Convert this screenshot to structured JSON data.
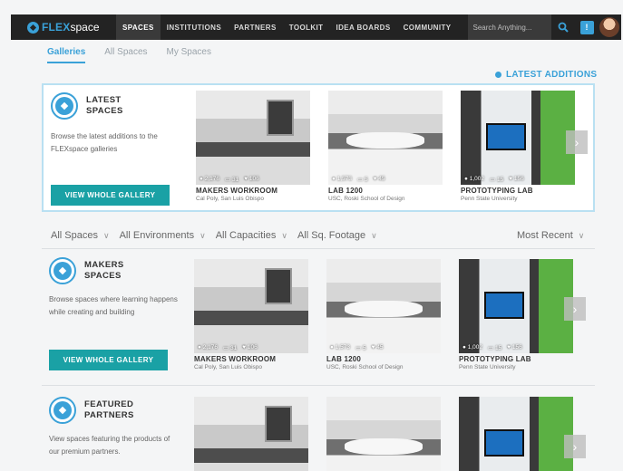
{
  "nav": {
    "logo_flex": "FLEX",
    "logo_space": "space",
    "items": [
      {
        "label": "SPACES",
        "active": true
      },
      {
        "label": "INSTITUTIONS",
        "active": false
      },
      {
        "label": "PARTNERS",
        "active": false
      },
      {
        "label": "TOOLKIT",
        "active": false
      },
      {
        "label": "IDEA BOARDS",
        "active": false
      },
      {
        "label": "COMMUNITY",
        "active": false
      }
    ],
    "search_placeholder": "Search Anything...",
    "notification_label": "!"
  },
  "subtabs": [
    {
      "label": "Galleries",
      "active": true
    },
    {
      "label": "All Spaces",
      "active": false
    },
    {
      "label": "My Spaces",
      "active": false
    }
  ],
  "latest_link": "LATEST ADDITIONS",
  "filters": {
    "items": [
      "All Spaces",
      "All Environments",
      "All Capacities",
      "All Sq. Footage"
    ],
    "sort": "Most Recent"
  },
  "cards": [
    {
      "name": "MAKERS WORKROOM",
      "location": "Cal Poly, San Luis Obispo",
      "views": "2,176",
      "comments": "31",
      "likes": "106"
    },
    {
      "name": "LAB 1200",
      "location": "USC, Roski School of Design",
      "views": "1,573",
      "comments": "5",
      "likes": "45"
    },
    {
      "name": "PROTOTYPING LAB",
      "location": "Penn State University",
      "views": "1,002",
      "comments": "15",
      "likes": "156"
    }
  ],
  "galleries": [
    {
      "title": "LATEST SPACES",
      "description": "Browse the latest additions to the FLEXspace galleries",
      "button": "VIEW WHOLE GALLERY"
    },
    {
      "title": "MAKERS SPACES",
      "description": "Browse spaces where learning happens while creating and building",
      "button": "VIEW WHOLE GALLERY"
    },
    {
      "title": "FEATURED PARTNERS",
      "description": "View spaces featuring the products of our premium partners.",
      "button": ""
    }
  ],
  "colors": {
    "accent": "#3aa1d8",
    "button": "#1aa1a5",
    "topbar": "#232323"
  }
}
